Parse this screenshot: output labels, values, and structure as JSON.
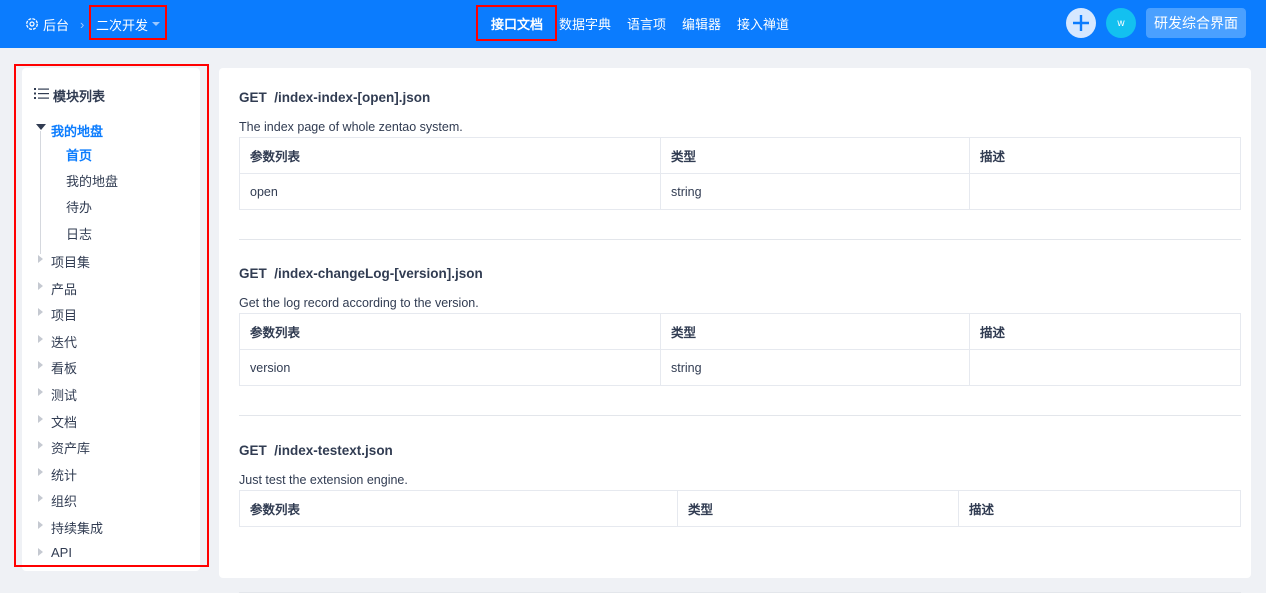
{
  "topbar": {
    "backend_label": "后台",
    "module_label": "二次开发",
    "nav": [
      "接口文档",
      "数据字典",
      "语言项",
      "编辑器",
      "接入禅道"
    ],
    "avatar_initial": "w",
    "switch_label": "研发综合界面",
    "brand_color": "#0b7cfe"
  },
  "sidebar": {
    "title": "模块列表",
    "groups": [
      {
        "label": "我的地盘",
        "expanded": true,
        "children": [
          "首页",
          "我的地盘",
          "待办",
          "日志"
        ]
      }
    ],
    "items": [
      "项目集",
      "产品",
      "项目",
      "迭代",
      "看板",
      "测试",
      "文档",
      "资产库",
      "统计",
      "组织",
      "持续集成",
      "API"
    ]
  },
  "apis": [
    {
      "method": "GET",
      "path": "/index-index-[open].json",
      "desc": "The index page of whole zentao system.",
      "headers": [
        "参数列表",
        "类型",
        "描述"
      ],
      "rows": [
        [
          "open",
          "string",
          ""
        ]
      ]
    },
    {
      "method": "GET",
      "path": "/index-changeLog-[version].json",
      "desc": "Get the log record according to the version.",
      "headers": [
        "参数列表",
        "类型",
        "描述"
      ],
      "rows": [
        [
          "version",
          "string",
          ""
        ]
      ]
    },
    {
      "method": "GET",
      "path": "/index-testext.json",
      "desc": "Just test the extension engine.",
      "headers": [
        "参数列表",
        "类型",
        "描述"
      ],
      "rows": []
    }
  ]
}
